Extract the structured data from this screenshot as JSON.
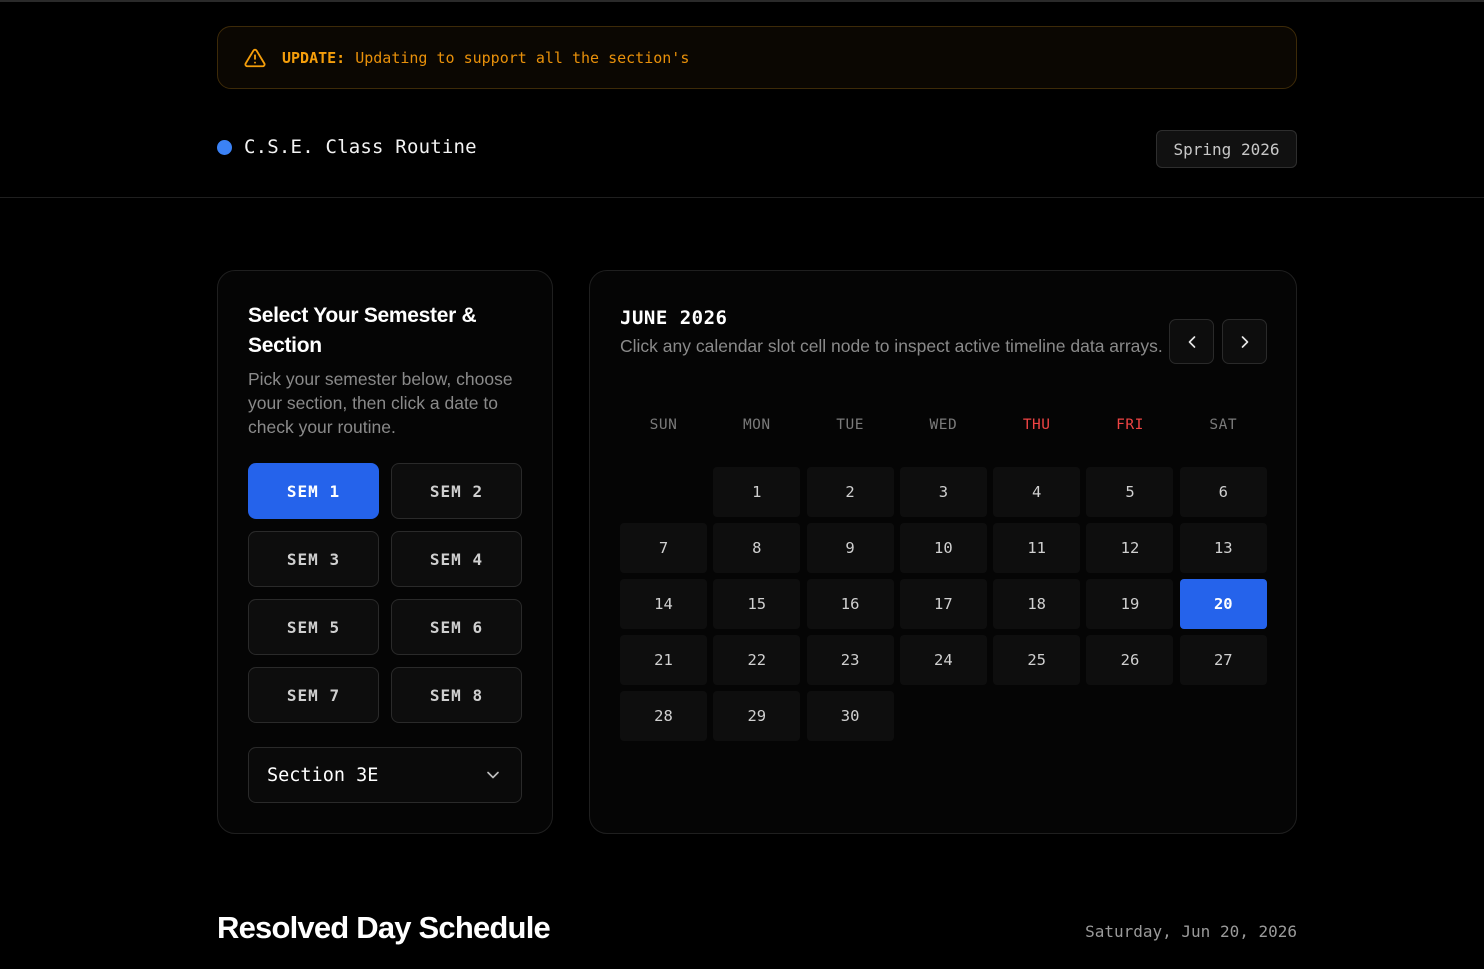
{
  "banner": {
    "tag": "UPDATE:",
    "message": "Updating to support all the section's",
    "icon": "warning-triangle-icon",
    "accent_color": "#f59e0b"
  },
  "header": {
    "title": "C.S.E. Class Routine",
    "term": "Spring 2026",
    "dot_color": "#3b82f6"
  },
  "selector": {
    "title": "Select Your Semester & Section",
    "description": "Pick your semester below, choose your section, then click a date to check your routine.",
    "semesters": [
      {
        "label": "SEM 1",
        "active": true
      },
      {
        "label": "SEM 2",
        "active": false
      },
      {
        "label": "SEM 3",
        "active": false
      },
      {
        "label": "SEM 4",
        "active": false
      },
      {
        "label": "SEM 5",
        "active": false
      },
      {
        "label": "SEM 6",
        "active": false
      },
      {
        "label": "SEM 7",
        "active": false
      },
      {
        "label": "SEM 8",
        "active": false
      }
    ],
    "section": {
      "value": "Section 3E",
      "icon": "chevron-down-icon"
    },
    "accent_color": "#2563eb"
  },
  "calendar": {
    "month_label": "JUNE 2026",
    "help_text": "Click any calendar slot cell node to inspect active timeline data arrays.",
    "prev_icon": "chevron-left-icon",
    "next_icon": "chevron-right-icon",
    "weekdays": [
      {
        "label": "SUN",
        "highlight": false
      },
      {
        "label": "MON",
        "highlight": false
      },
      {
        "label": "TUE",
        "highlight": false
      },
      {
        "label": "WED",
        "highlight": false
      },
      {
        "label": "THU",
        "highlight": true
      },
      {
        "label": "FRI",
        "highlight": true
      },
      {
        "label": "SAT",
        "highlight": false
      }
    ],
    "leading_blank_days": 1,
    "days": [
      "1",
      "2",
      "3",
      "4",
      "5",
      "6",
      "7",
      "8",
      "9",
      "10",
      "11",
      "12",
      "13",
      "14",
      "15",
      "16",
      "17",
      "18",
      "19",
      "20",
      "21",
      "22",
      "23",
      "24",
      "25",
      "26",
      "27",
      "28",
      "29",
      "30"
    ],
    "selected_day": "20",
    "highlight_color": "#ef4444"
  },
  "schedule": {
    "title": "Resolved Day Schedule",
    "date": "Saturday, Jun 20, 2026"
  }
}
